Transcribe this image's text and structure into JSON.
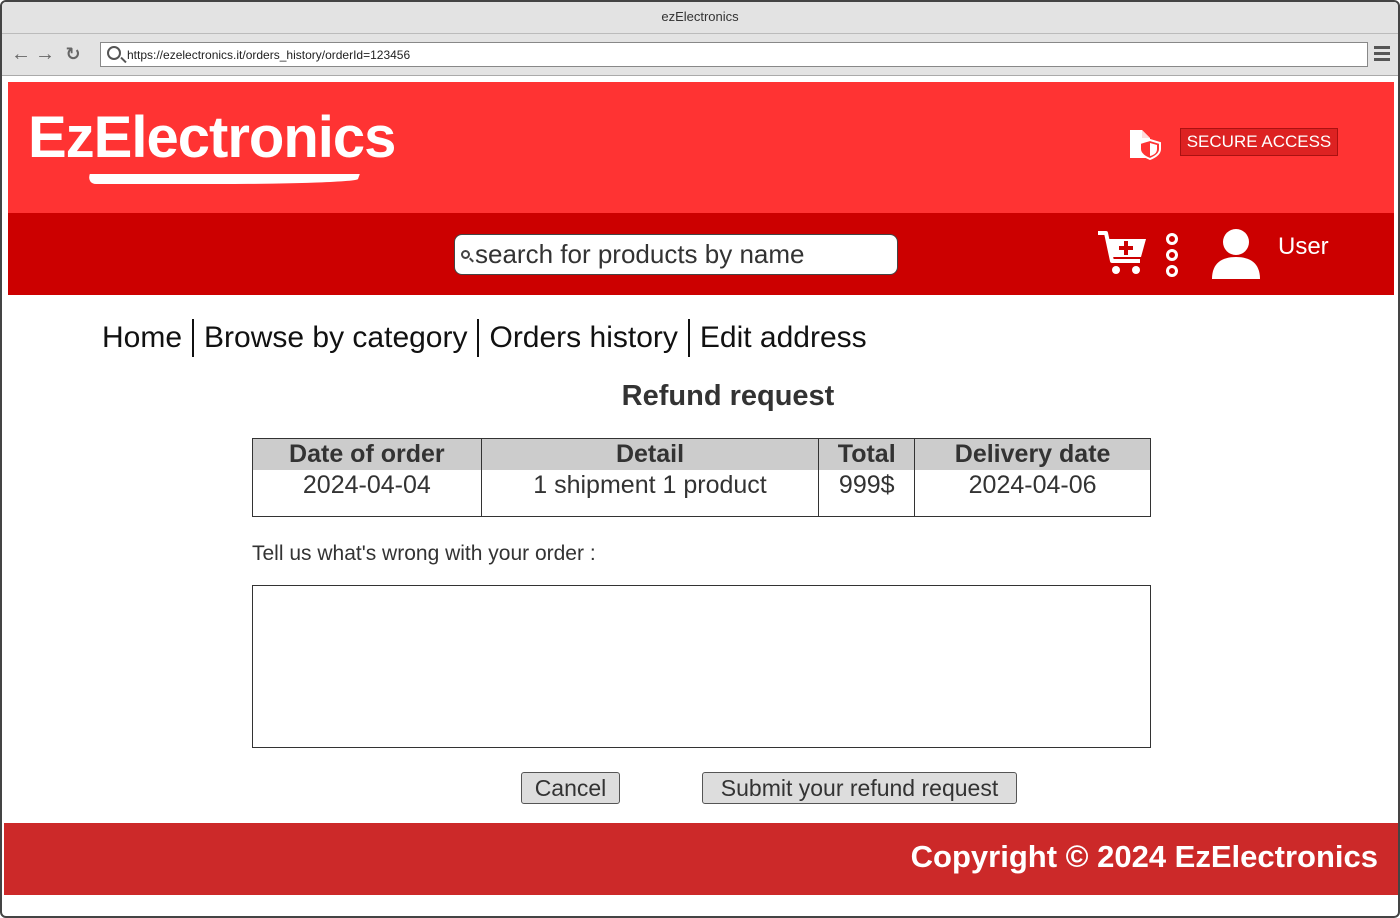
{
  "window": {
    "title": "ezElectronics"
  },
  "browser": {
    "url": "https://ezelectronics.it/orders_history/orderId=123456"
  },
  "header": {
    "logo_text": "EzElectronics",
    "secure_access_label": "SECURE ACCESS",
    "search_placeholder": "search for products by name",
    "user_label": "User"
  },
  "nav": {
    "items": [
      {
        "label": "Home"
      },
      {
        "label": "Browse by category"
      },
      {
        "label": "Orders history"
      },
      {
        "label": "Edit address"
      }
    ]
  },
  "page": {
    "title": "Refund request"
  },
  "order_table": {
    "headers": [
      "Date of order",
      "Detail",
      "Total",
      "Delivery date"
    ],
    "rows": [
      [
        "2024-04-04",
        "1 shipment 1 product",
        "999$",
        "2024-04-06"
      ]
    ]
  },
  "refund_form": {
    "prompt": "Tell us what's wrong with your order :",
    "textarea_value": "",
    "cancel_label": "Cancel",
    "submit_label": "Submit your refund request"
  },
  "footer": {
    "copyright": "Copyright © 2024 EzElectronics"
  },
  "colors": {
    "header_top": "#ff3333",
    "header_bottom": "#cc0000",
    "footer": "#cc2929",
    "table_header": "#cccccc"
  }
}
